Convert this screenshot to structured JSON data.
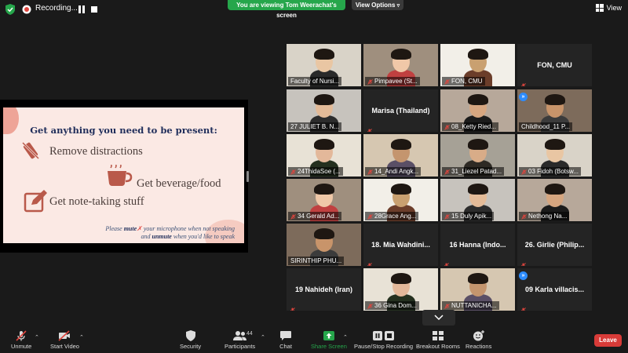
{
  "topbar": {
    "recording_label": "Recording...",
    "viewing_banner": "You are viewing Tom Weerachat's screen",
    "view_options_label": "View Options",
    "view_label": "View"
  },
  "slide": {
    "title": "Get anything you need to be present:",
    "item1": "Remove distractions",
    "item2": "Get beverage/food",
    "item3": "Get note-taking stuff",
    "note_line1_a": "Please ",
    "note_line1_b": "mute",
    "note_line1_c": " your microphone when not speaking",
    "note_line2_a": "and ",
    "note_line2_b": "unmute",
    "note_line2_c": " when you'd like to speak"
  },
  "participants": [
    {
      "name": "Faculty of Nursi...",
      "video": true,
      "muted": false,
      "active": true
    },
    {
      "name": "Pimpavee (St...",
      "video": true,
      "muted": true
    },
    {
      "name": "FON, CMU",
      "video": true,
      "muted": true
    },
    {
      "name": "FON, CMU",
      "video": false,
      "muted": true
    },
    {
      "name": "27 JULIET B. N...",
      "video": true,
      "muted": false
    },
    {
      "name": "Marisa (Thailand)",
      "video": false,
      "muted": true
    },
    {
      "name": "08_Ketty Ried...",
      "video": true,
      "muted": true
    },
    {
      "name": "Childhood_11 P...",
      "video": true,
      "muted": false,
      "forwarded": true
    },
    {
      "name": "24ThidaSoe (...",
      "video": true,
      "muted": true
    },
    {
      "name": "14_Andi Angk...",
      "video": true,
      "muted": true
    },
    {
      "name": "31_Liezel Patad...",
      "video": true,
      "muted": true
    },
    {
      "name": "03 Fidoh (Botsw...",
      "video": true,
      "muted": true
    },
    {
      "name": "34 Gerald Ad...",
      "video": true,
      "muted": true
    },
    {
      "name": "28Grace Ang...",
      "video": true,
      "muted": true
    },
    {
      "name": "15 Duly Apik...",
      "video": true,
      "muted": true
    },
    {
      "name": "Nethong Na...",
      "video": true,
      "muted": true
    },
    {
      "name": "SIRINTHIP PHU...",
      "video": true,
      "muted": false
    },
    {
      "name": "18. Mia Wahdini...",
      "video": false,
      "muted": true
    },
    {
      "name": "16 Hanna (Indo...",
      "video": false,
      "muted": true
    },
    {
      "name": "26. Girlie (Philip...",
      "video": false,
      "muted": true
    },
    {
      "name": "19 Nahideh (Iran)",
      "video": false,
      "muted": true
    },
    {
      "name": "36 Gina Dom...",
      "video": true,
      "muted": true
    },
    {
      "name": "NUTTANICHA...",
      "video": true,
      "muted": true
    },
    {
      "name": "09 Karla villacis...",
      "video": false,
      "muted": true,
      "forwarded": true
    }
  ],
  "toolbar": {
    "unmute": "Unmute",
    "start_video": "Start Video",
    "security": "Security",
    "participants": "Participants",
    "participants_count": "44",
    "chat": "Chat",
    "share_screen": "Share Screen",
    "pause_recording": "Pause/Stop Recording",
    "breakout_rooms": "Breakout Rooms",
    "reactions": "Reactions",
    "leave": "Leave"
  },
  "colors": {
    "accent_green": "#26a64b",
    "active_speaker": "#c6dd3f",
    "leave_red": "#d83b38",
    "mute_red": "#e0453e",
    "slide_bg": "#fbe9e4",
    "slide_title": "#1f2d5a",
    "slide_icon": "#b9594a"
  }
}
